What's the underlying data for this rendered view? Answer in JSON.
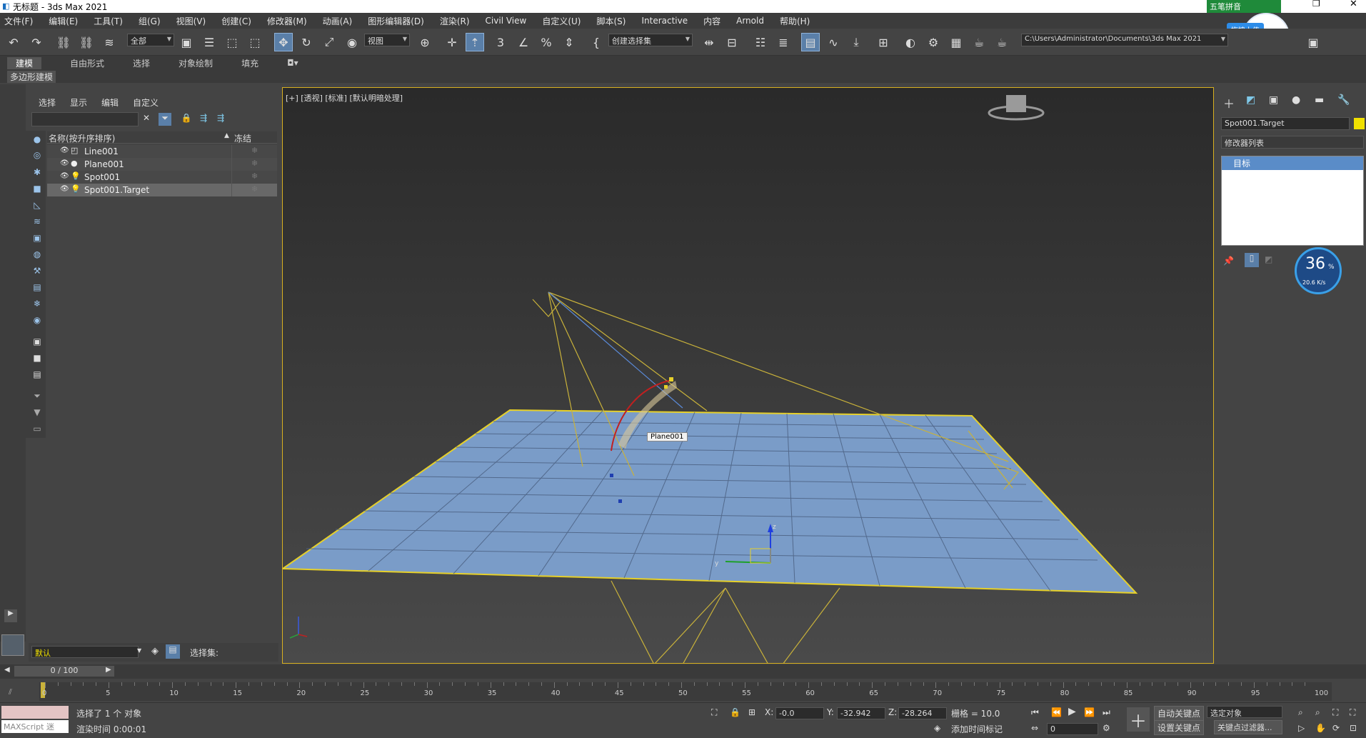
{
  "app": {
    "title": "无标题 - 3ds Max 2021"
  },
  "menu": [
    "文件(F)",
    "编辑(E)",
    "工具(T)",
    "组(G)",
    "视图(V)",
    "创建(C)",
    "修改器(M)",
    "动画(A)",
    "图形编辑器(D)",
    "渲染(R)",
    "Civil View",
    "自定义(U)",
    "脚本(S)",
    "Interactive",
    "内容",
    "Arnold",
    "帮助(H)"
  ],
  "toolbar": {
    "selection_filter": "全部",
    "ref_coord": "视图",
    "named_selection": "创建选择集",
    "path": "C:\\Users\\Administrator\\Documents\\3ds Max 2021"
  },
  "ribbon": {
    "tabs": [
      "建模",
      "自由形式",
      "选择",
      "对象绘制",
      "填充"
    ],
    "active": "建模",
    "sub": "多边形建模"
  },
  "scene": {
    "tabs": [
      "选择",
      "显示",
      "编辑",
      "自定义"
    ],
    "col_name": "名称(按升序排序)",
    "col_freeze": "冻结",
    "rows": [
      {
        "name": "Line001"
      },
      {
        "name": "Plane001"
      },
      {
        "name": "Spot001"
      },
      {
        "name": "Spot001.Target"
      }
    ],
    "layer": "默认",
    "selection_set": "选择集:"
  },
  "viewport": {
    "label": "[+] [透视] [标准] [默认明暗处理]",
    "tooltip": "Plane001",
    "axis_z": "z",
    "axis_y": "y"
  },
  "cmd": {
    "object_name": "Spot001.Target",
    "modifier_list": "修改器列表",
    "stack_item": "目标"
  },
  "ime": {
    "name": "五笔拼音",
    "upload": "拖拽上传",
    "net_pct": "36",
    "net_unit": "%",
    "net_speed": "20.6 K/s"
  },
  "timeline": {
    "frame": "0 / 100",
    "ticks": [
      "0",
      "5",
      "10",
      "15",
      "20",
      "25",
      "30",
      "35",
      "40",
      "45",
      "50",
      "55",
      "60",
      "65",
      "70",
      "75",
      "80",
      "85",
      "90",
      "95",
      "100"
    ]
  },
  "status": {
    "maxscript": "MAXScript 迷",
    "selected": "选择了 1 个 对象",
    "render_time": "渲染时间  0:00:01",
    "x_label": "X:",
    "x": "-0.0",
    "y_label": "Y:",
    "y": "-32.942",
    "z_label": "Z:",
    "z": "-28.264",
    "grid": "栅格 = 10.0",
    "add_tag": "添加时间标记",
    "auto_key": "自动关键点",
    "set_key": "设置关键点",
    "key_mode": "选定对象",
    "key_filter": "关键点过滤器...",
    "frame": "0"
  },
  "colors": {
    "accent": "#5a7fa8",
    "plane": "#7a9cc8",
    "selection": "#e6d02a",
    "swatch": "#f0e000"
  }
}
